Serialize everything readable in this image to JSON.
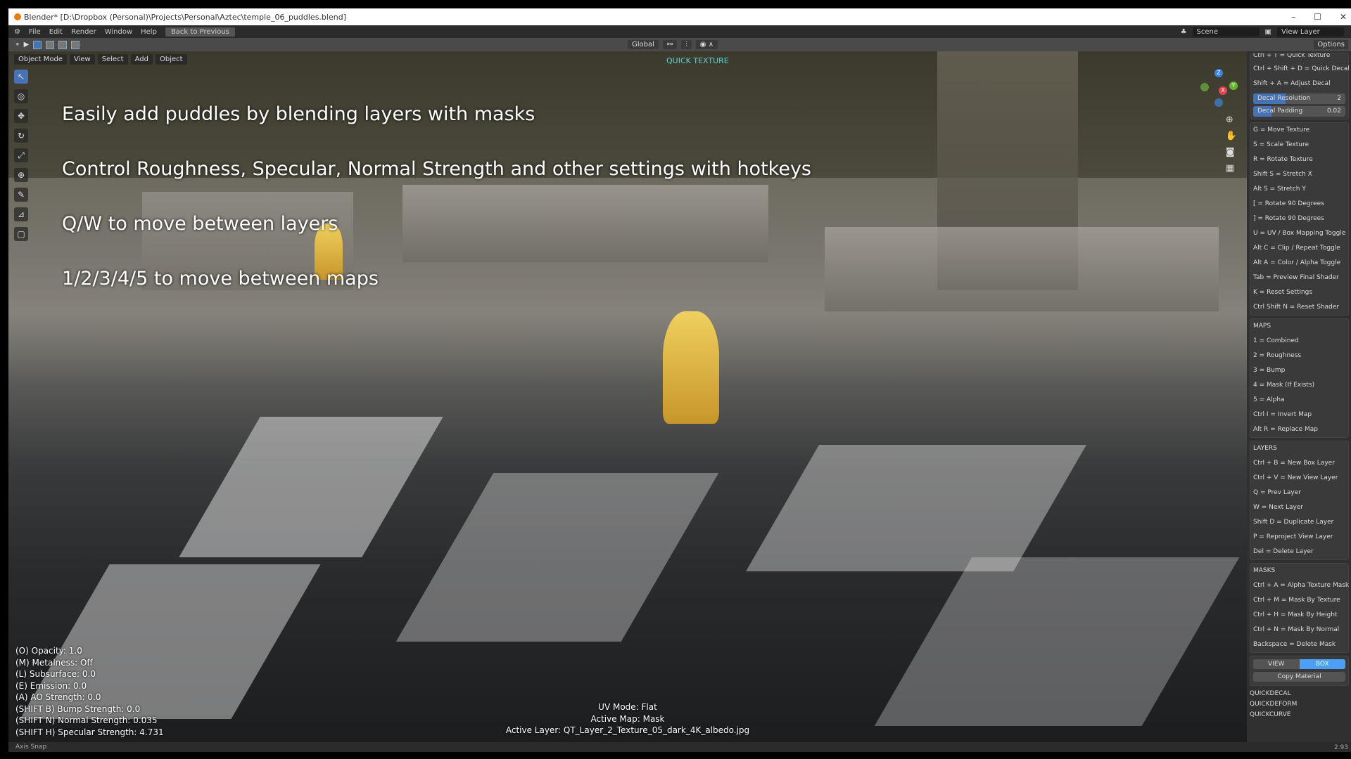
{
  "window": {
    "title": "Blender* [D:\\Dropbox (Personal)\\Projects\\Personal\\Aztec\\temple_06_puddles.blend]"
  },
  "menu": {
    "items": [
      "File",
      "Edit",
      "Render",
      "Window",
      "Help"
    ],
    "back": "Back to Previous",
    "scene": "Scene",
    "view_layer": "View Layer"
  },
  "header": {
    "transform": "Global",
    "options": "Options",
    "mode": "Object Mode",
    "menus": [
      "View",
      "Select",
      "Add",
      "Object"
    ]
  },
  "viewport": {
    "addon_title": "QUICK TEXTURE",
    "overlay_lines": [
      "Easily add puddles by blending layers with masks",
      "Control Roughness, Specular, Normal Strength and other settings with hotkeys",
      "Q/W to move between layers",
      "1/2/3/4/5 to move between maps"
    ],
    "properties": [
      "(O) Opacity: 1.0",
      "(M) Metalness: Off",
      "(L) Subsurface: 0.0",
      "(E) Emission: 0.0",
      "(A) AO Strength: 0.0",
      "(SHIFT B) Bump Strength: 0.0",
      "(SHIFT N) Normal Strength: 0.035",
      "(SHIFT H) Specular Strength: 4.731"
    ],
    "status": [
      "UV Mode: Flat",
      "Active Map: Mask",
      "Active Layer: QT_Layer_2_Texture_05_dark_4K_albedo.jpg"
    ],
    "gizmo": {
      "z": "Z",
      "x": "X",
      "y": "Y"
    }
  },
  "panel": {
    "top": [
      "Ctrl + T = Quick Texture",
      "Ctrl + Shift + D = Quick Decal",
      "Shift + A = Adjust Decal"
    ],
    "decal_resolution": {
      "label": "Decal Resolution",
      "value": "2"
    },
    "decal_padding": {
      "label": "Decal Padding",
      "value": "0.02"
    },
    "texture_keys": [
      "G = Move Texture",
      "S = Scale Texture",
      "R = Rotate Texture",
      "Shift S = Stretch X",
      "Alt S = Stretch Y",
      "[ = Rotate 90 Degrees",
      "] = Rotate 90 Degrees",
      "U = UV / Box Mapping Toggle",
      "Alt C = Clip / Repeat Toggle",
      "Alt A = Color / Alpha Toggle",
      "Tab = Preview Final Shader",
      "K = Reset Settings",
      "Ctrl Shift N = Reset Shader"
    ],
    "maps": {
      "title": "MAPS",
      "items": [
        "1 = Combined",
        "2 = Roughness",
        "3 = Bump",
        "4 = Mask (If Exists)",
        "5 = Alpha",
        "Ctrl I = Invert Map",
        "Alt R = Replace Map"
      ]
    },
    "layers": {
      "title": "LAYERS",
      "items": [
        "Ctrl + B = New Box Layer",
        "Ctrl + V = New View Layer",
        "Q = Prev Layer",
        "W = Next Layer",
        "Shift D = Duplicate Layer",
        "P = Reproject View Layer",
        "Del = Delete Layer"
      ]
    },
    "masks": {
      "title": "MASKS",
      "items": [
        "Ctrl + A = Alpha Texture Mask",
        "Ctrl + M = Mask By Texture",
        "Ctrl + H = Mask By Height",
        "Ctrl + N = Mask By Normal",
        "Backspace = Delete Mask"
      ]
    },
    "view_label": "VIEW",
    "box_label": "BOX",
    "active_mode": "BOX",
    "copy_material": "Copy Material",
    "subpanels": [
      "QUICKDECAL",
      "QUICKDEFORM",
      "QUICKCURVE"
    ]
  },
  "statusbar": {
    "hint": "Axis Snap",
    "version": "2.93"
  },
  "colors": {
    "accent": "#4772b3",
    "addon_title": "#5fd6d0",
    "toggle_on": "#4d9ff5"
  }
}
